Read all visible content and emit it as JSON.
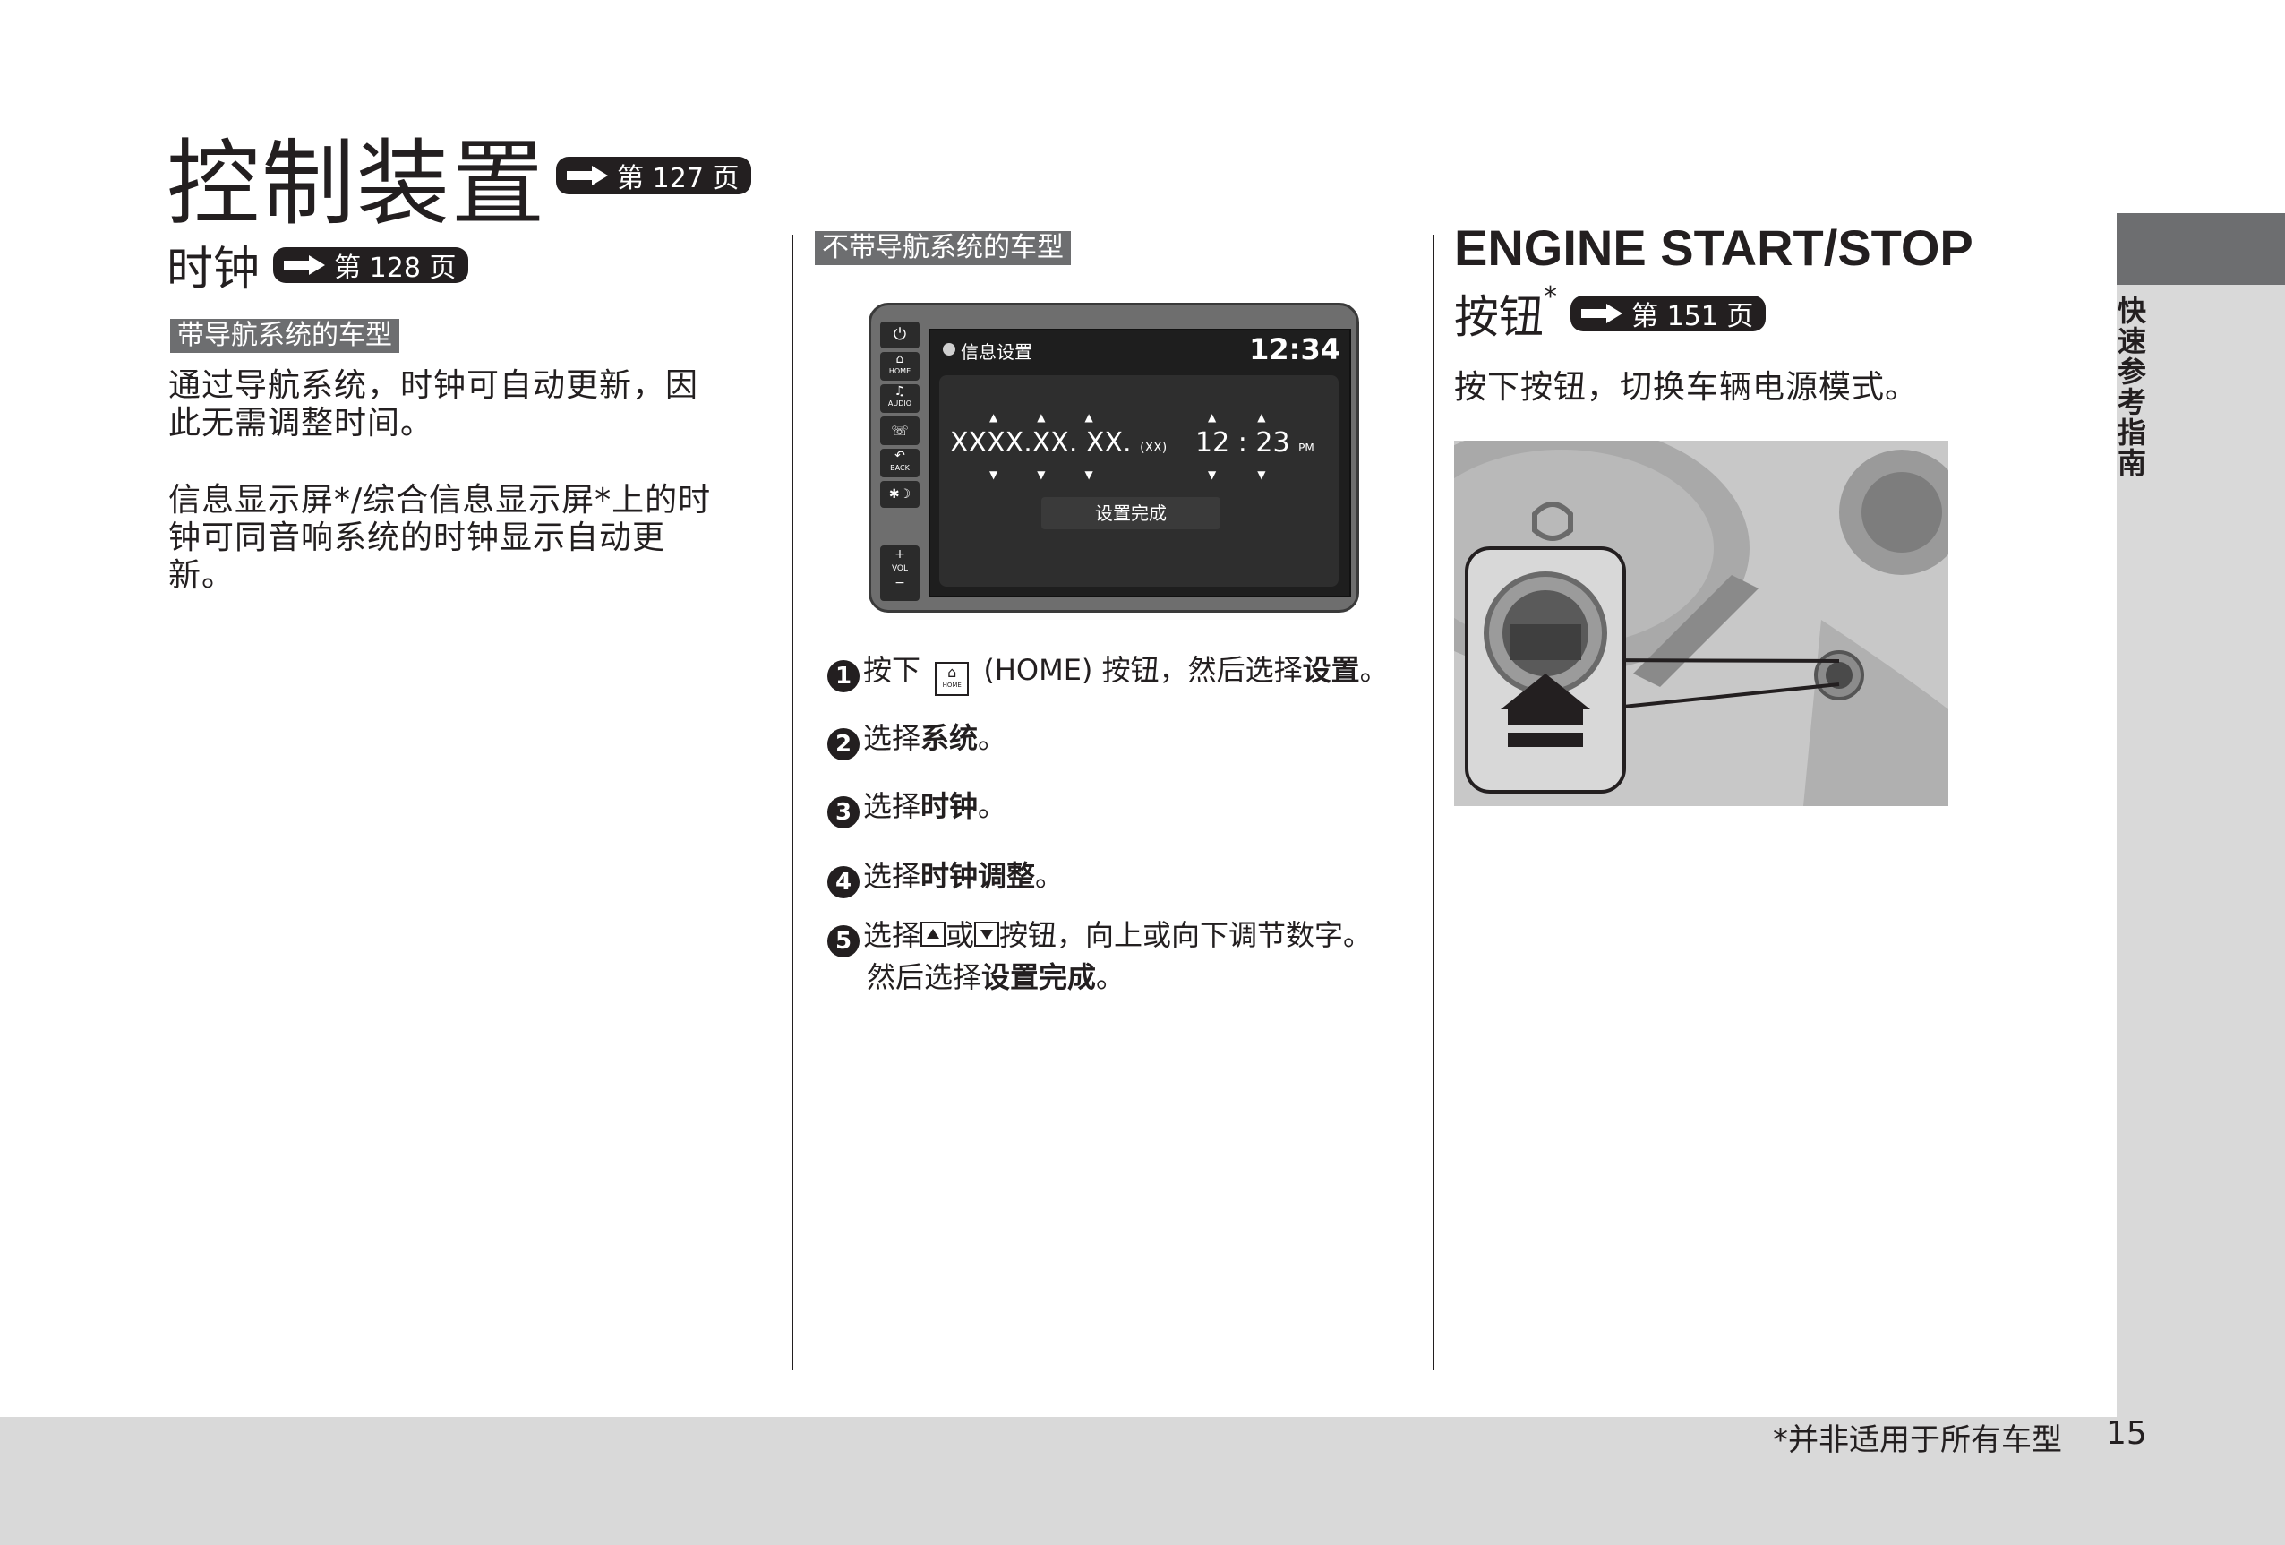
{
  "page": {
    "title": "控制装置",
    "title_ref": "第 127 页",
    "page_number": "15",
    "footnote": "*并非适用于所有车型",
    "side_tab": "快速参考指南"
  },
  "clock": {
    "heading": "时钟",
    "ref": "第 128 页",
    "nav_label": "带导航系统的车型",
    "nav_text_1": "通过导航系统，时钟可自动更新，因",
    "nav_text_2": "此无需调整时间。",
    "display_text_1": "信息显示屏*/综合信息显示屏*上的时",
    "display_text_2": "钟可同音响系统的时钟显示自动更",
    "display_text_3": "新。",
    "no_nav_label": "不带导航系统的车型"
  },
  "screen": {
    "header": "信息设置",
    "time": "12:34",
    "date_value": "XXXX.XX. XX.",
    "date_suffix": "(XX)",
    "clock_value": "12 : 23",
    "clock_ampm": "PM",
    "done_button": "设置完成",
    "side_buttons": [
      "HOME",
      "AUDIO",
      "BACK"
    ],
    "vol_label": "VOL"
  },
  "steps": [
    {
      "num": "1",
      "pre": "按下",
      "key": "HOME",
      "mid": "(HOME) 按钮，然后选择",
      "bold": "设置",
      "post": "。"
    },
    {
      "num": "2",
      "pre": "选择",
      "bold": "系统",
      "post": "。"
    },
    {
      "num": "3",
      "pre": "选择",
      "bold": "时钟",
      "post": "。"
    },
    {
      "num": "4",
      "pre": "选择",
      "bold": "时钟调整",
      "post": "。"
    },
    {
      "num": "5",
      "pre": "选择",
      "mid1": "或",
      "mid2": "按钮，向上或向下调节数字。",
      "line2_pre": "然后选择",
      "bold": "设置完成",
      "post": "。"
    }
  ],
  "engine": {
    "heading_1": "ENGINE START/STOP",
    "heading_2": "按钮",
    "asterisk": "*",
    "ref": "第 151 页",
    "text": "按下按钮，切换车辆电源模式。"
  },
  "colors": {
    "text": "#231f20",
    "label_bg": "#6d6e70",
    "footer_bg": "#d9d9d9",
    "tab_bg": "#6d6e70"
  }
}
